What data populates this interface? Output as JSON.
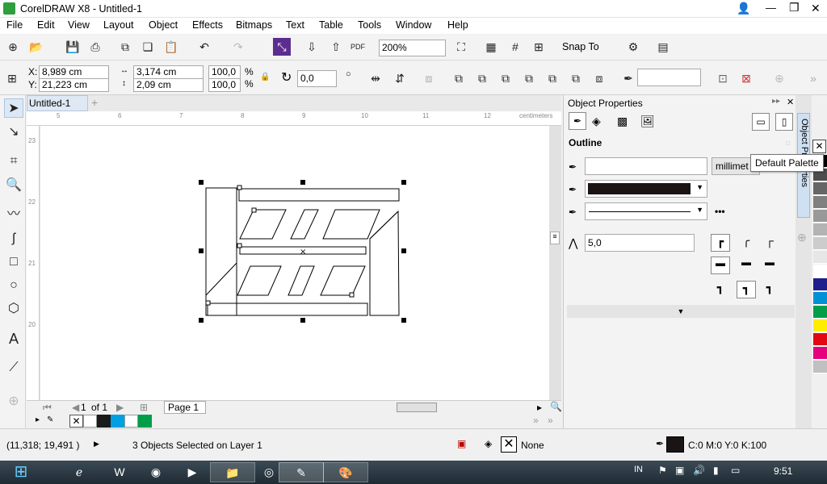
{
  "window": {
    "title": "CorelDRAW X8 - Untitled-1",
    "min": "—",
    "max": "❐",
    "close": "✕"
  },
  "menu": [
    "File",
    "Edit",
    "View",
    "Layout",
    "Object",
    "Effects",
    "Bitmaps",
    "Text",
    "Table",
    "Tools",
    "Window",
    "Help"
  ],
  "toolbar1": {
    "zoom": "200%",
    "snap": "Snap To"
  },
  "toolbar2": {
    "x_label": "X:",
    "x_value": "8,989 cm",
    "y_label": "Y:",
    "y_value": "21,223 cm",
    "w_value": "3,174 cm",
    "h_value": "2,09 cm",
    "sx": "100,0",
    "sy": "100,0",
    "pct": "%",
    "angle": "0,0"
  },
  "document": {
    "tab": "Untitled-1",
    "ruler_units": "centimeters",
    "ruler_top": [
      "5",
      "6",
      "7",
      "8",
      "9",
      "10",
      "11",
      "12"
    ],
    "ruler_left": [
      "23",
      "22",
      "21",
      "20"
    ]
  },
  "pagebar": {
    "current": "1",
    "of": "of 1",
    "page_tab": "Page 1"
  },
  "objprops": {
    "title": "Object Properties",
    "section": "Outline",
    "units": "millimet",
    "width": "5,0",
    "docker_tab": "Object Properties"
  },
  "tooltip": "Default Palette",
  "status": {
    "coords": "(11,318; 19,491 )",
    "selection": "3 Objects Selected on Layer 1",
    "fill": "None",
    "outline_cmyk": "C:0 M:0 Y:0 K:100"
  },
  "taskbar": {
    "lang": "IN",
    "time": "9:51"
  },
  "colors": {
    "palette_swatches": [
      "#ffffff",
      "#1a1a1a",
      "#00a0e3",
      "#ffffff",
      "#009e49"
    ],
    "right_palette": [
      "#000000",
      "#4d4d4d",
      "#666666",
      "#808080",
      "#999999",
      "#b3b3b3",
      "#cccccc",
      "#e6e6e6",
      "#ffffff",
      "#1e1e8c",
      "#0091d5",
      "#009e49",
      "#ffed00",
      "#e30613",
      "#e5007d",
      "#c0c0c0"
    ]
  }
}
